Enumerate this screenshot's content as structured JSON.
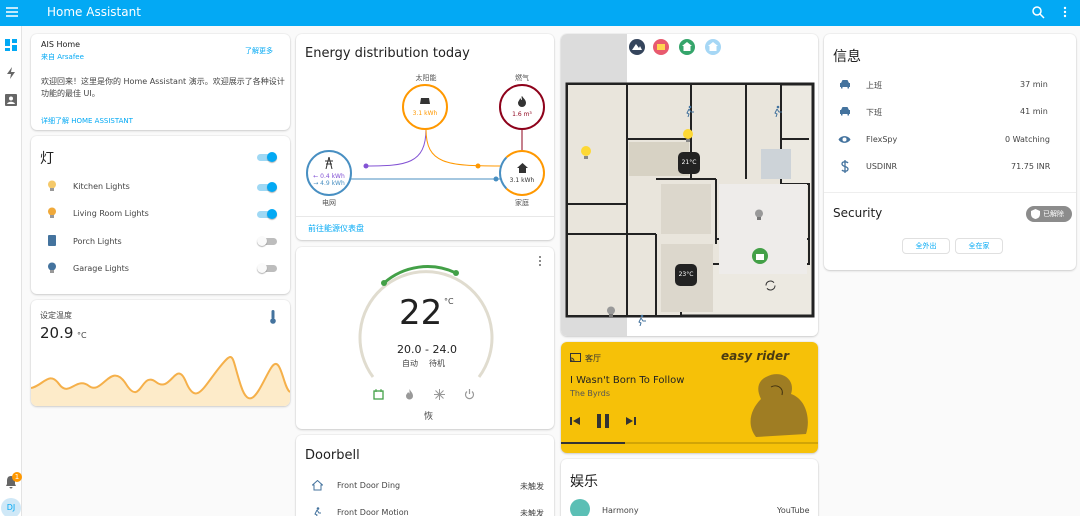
{
  "app": {
    "title": "Home Assistant",
    "notification_count": "1",
    "user_initials": "DJ"
  },
  "colors": {
    "accent": "#03a9f4",
    "solar": "#ff9800",
    "gas": "#8e021b",
    "grid_return": "#8353d4",
    "grid": "#488fc2",
    "home": "#ff9800",
    "media_bg": "#f6c108",
    "thermostat": "#43a047"
  },
  "welcome": {
    "title": "AIS Home",
    "subtitle": "来自 Arsafee",
    "action": "了解更多",
    "body": "欢迎回来！这里是你的 Home Assistant 演示。欢迎展示了各种设计功能的最佳 UI。",
    "link": "详细了解 HOME ASSISTANT"
  },
  "lights": {
    "title": "灯",
    "items": [
      {
        "name": "Kitchen Lights",
        "on": true,
        "icon": "bulb-icon"
      },
      {
        "name": "Living Room Lights",
        "on": true,
        "icon": "bulb-icon"
      },
      {
        "name": "Porch Lights",
        "on": false,
        "icon": "porch-light-icon"
      },
      {
        "name": "Garage Lights",
        "on": false,
        "icon": "bulb-icon"
      }
    ]
  },
  "temperature": {
    "label": "设定温度",
    "value": "20.9",
    "unit": "°C"
  },
  "energy": {
    "title": "Energy distribution today",
    "solar": {
      "label": "太阳能",
      "value": "3.1 kWh"
    },
    "gas": {
      "label": "燃气",
      "value": "1.6 m³"
    },
    "grid": {
      "label": "电网",
      "in": "← 0.4 kWh",
      "out": "→ 4.9 kWh"
    },
    "home": {
      "label": "家庭",
      "value": "3.1 kWh"
    },
    "link": "前往能源仪表盘"
  },
  "thermostat": {
    "target": "22",
    "unit": "°C",
    "range": "20.0 - 24.0",
    "mode": "自动",
    "action": "待机",
    "preset": "恢"
  },
  "doorbell": {
    "title": "Doorbell",
    "rows": [
      {
        "name": "Front Door Ding",
        "state": "未触发",
        "icon": "house-icon"
      },
      {
        "name": "Front Door Motion",
        "state": "未触发",
        "icon": "motion-icon"
      }
    ]
  },
  "media": {
    "source": "客厅",
    "track": "I Wasn't Born To Follow",
    "artist": "The Byrds",
    "album_title": "easy rider",
    "progress": 0.25
  },
  "entertainment": {
    "title": "娱乐",
    "item": "Harmony",
    "state": "YouTube"
  },
  "info": {
    "title": "信息",
    "rows": [
      {
        "icon": "car-icon",
        "name": "上班",
        "value": "37 min"
      },
      {
        "icon": "car-icon",
        "name": "下班",
        "value": "41 min"
      },
      {
        "icon": "eye-icon",
        "name": "FlexSpy",
        "value": "0 Watching"
      },
      {
        "icon": "dollar-icon",
        "name": "USDINR",
        "value": "71.75 INR"
      }
    ]
  },
  "security": {
    "title": "Security",
    "badge": "已解除",
    "buttons": [
      "全外出",
      "全在家"
    ]
  },
  "floorplan": {
    "temps": [
      "21°C",
      "23°C"
    ]
  }
}
